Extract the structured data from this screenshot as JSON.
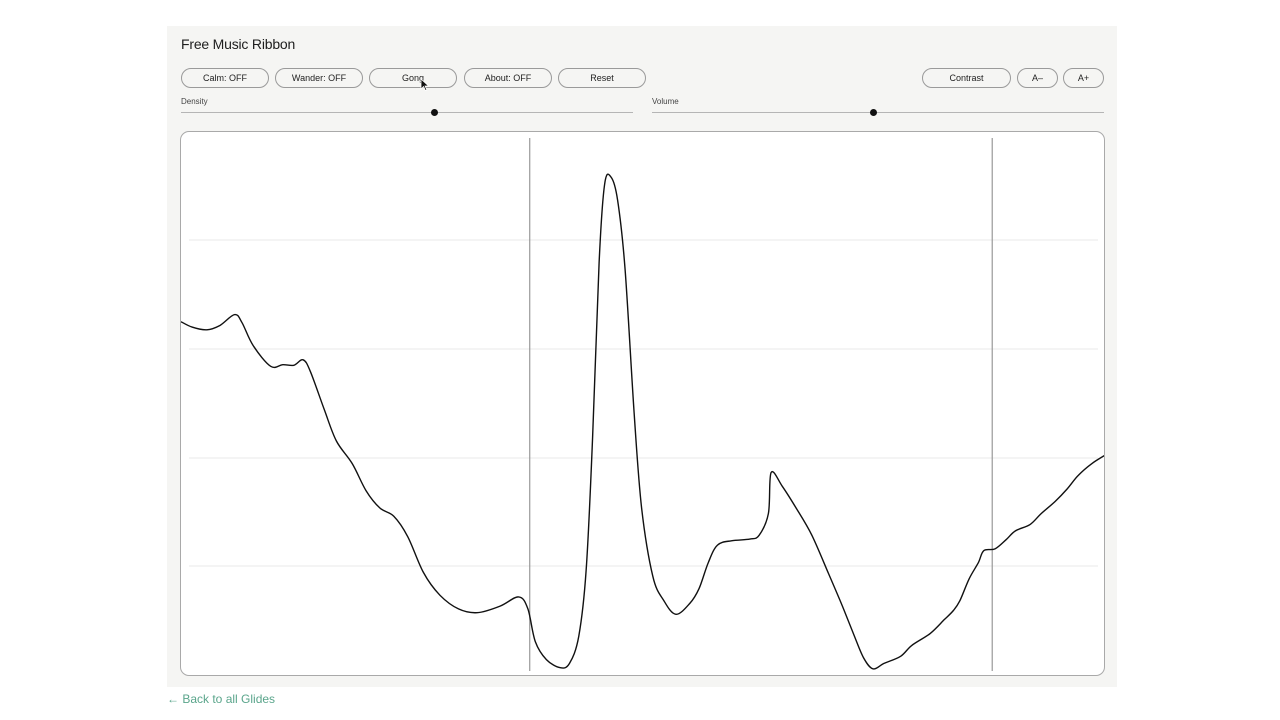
{
  "app": {
    "title": "Free Music Ribbon"
  },
  "toolbar": {
    "calm_label": "Calm: OFF",
    "wander_label": "Wander: OFF",
    "gong_label": "Gong",
    "about_label": "About: OFF",
    "reset_label": "Reset",
    "contrast_label": "Contrast",
    "font_smaller_label": "A–",
    "font_larger_label": "A+"
  },
  "sliders": {
    "density": {
      "label": "Density",
      "value": 0.56
    },
    "volume": {
      "label": "Volume",
      "value": 0.49
    }
  },
  "ribbon": {
    "markers": [
      0.377,
      0.877
    ],
    "curve": [
      [
        0.0,
        0.348
      ],
      [
        0.012,
        0.358
      ],
      [
        0.028,
        0.363
      ],
      [
        0.042,
        0.355
      ],
      [
        0.058,
        0.335
      ],
      [
        0.066,
        0.35
      ],
      [
        0.078,
        0.392
      ],
      [
        0.097,
        0.43
      ],
      [
        0.11,
        0.427
      ],
      [
        0.122,
        0.428
      ],
      [
        0.132,
        0.418
      ],
      [
        0.14,
        0.44
      ],
      [
        0.155,
        0.51
      ],
      [
        0.168,
        0.567
      ],
      [
        0.185,
        0.608
      ],
      [
        0.2,
        0.658
      ],
      [
        0.215,
        0.69
      ],
      [
        0.23,
        0.705
      ],
      [
        0.245,
        0.742
      ],
      [
        0.262,
        0.808
      ],
      [
        0.28,
        0.85
      ],
      [
        0.3,
        0.875
      ],
      [
        0.32,
        0.882
      ],
      [
        0.345,
        0.87
      ],
      [
        0.365,
        0.853
      ],
      [
        0.375,
        0.875
      ],
      [
        0.383,
        0.935
      ],
      [
        0.395,
        0.968
      ],
      [
        0.41,
        0.983
      ],
      [
        0.42,
        0.975
      ],
      [
        0.43,
        0.925
      ],
      [
        0.438,
        0.805
      ],
      [
        0.445,
        0.56
      ],
      [
        0.452,
        0.24
      ],
      [
        0.458,
        0.095
      ],
      [
        0.465,
        0.083
      ],
      [
        0.472,
        0.125
      ],
      [
        0.48,
        0.25
      ],
      [
        0.49,
        0.52
      ],
      [
        0.498,
        0.69
      ],
      [
        0.51,
        0.815
      ],
      [
        0.522,
        0.86
      ],
      [
        0.535,
        0.885
      ],
      [
        0.55,
        0.865
      ],
      [
        0.56,
        0.838
      ],
      [
        0.57,
        0.79
      ],
      [
        0.58,
        0.758
      ],
      [
        0.595,
        0.75
      ],
      [
        0.615,
        0.747
      ],
      [
        0.625,
        0.74
      ],
      [
        0.635,
        0.7
      ],
      [
        0.638,
        0.625
      ],
      [
        0.65,
        0.65
      ],
      [
        0.665,
        0.69
      ],
      [
        0.682,
        0.74
      ],
      [
        0.7,
        0.81
      ],
      [
        0.715,
        0.87
      ],
      [
        0.728,
        0.925
      ],
      [
        0.738,
        0.965
      ],
      [
        0.748,
        0.985
      ],
      [
        0.76,
        0.975
      ],
      [
        0.778,
        0.962
      ],
      [
        0.79,
        0.942
      ],
      [
        0.81,
        0.92
      ],
      [
        0.825,
        0.895
      ],
      [
        0.835,
        0.878
      ],
      [
        0.842,
        0.86
      ],
      [
        0.852,
        0.82
      ],
      [
        0.862,
        0.79
      ],
      [
        0.868,
        0.768
      ],
      [
        0.88,
        0.765
      ],
      [
        0.892,
        0.748
      ],
      [
        0.902,
        0.732
      ],
      [
        0.918,
        0.72
      ],
      [
        0.93,
        0.7
      ],
      [
        0.945,
        0.678
      ],
      [
        0.958,
        0.655
      ],
      [
        0.97,
        0.63
      ],
      [
        0.985,
        0.608
      ],
      [
        1.0,
        0.592
      ]
    ]
  },
  "footer": {
    "back_link": "← Back to all Glides"
  },
  "colors": {
    "panel_bg": "#f5f5f3",
    "ribbon_line": "#111111",
    "grid_line": "#e8e8e8",
    "marker_line": "#999999",
    "link": "#5aa58b"
  },
  "icons": {
    "cursor": "pointer-cursor-icon"
  }
}
